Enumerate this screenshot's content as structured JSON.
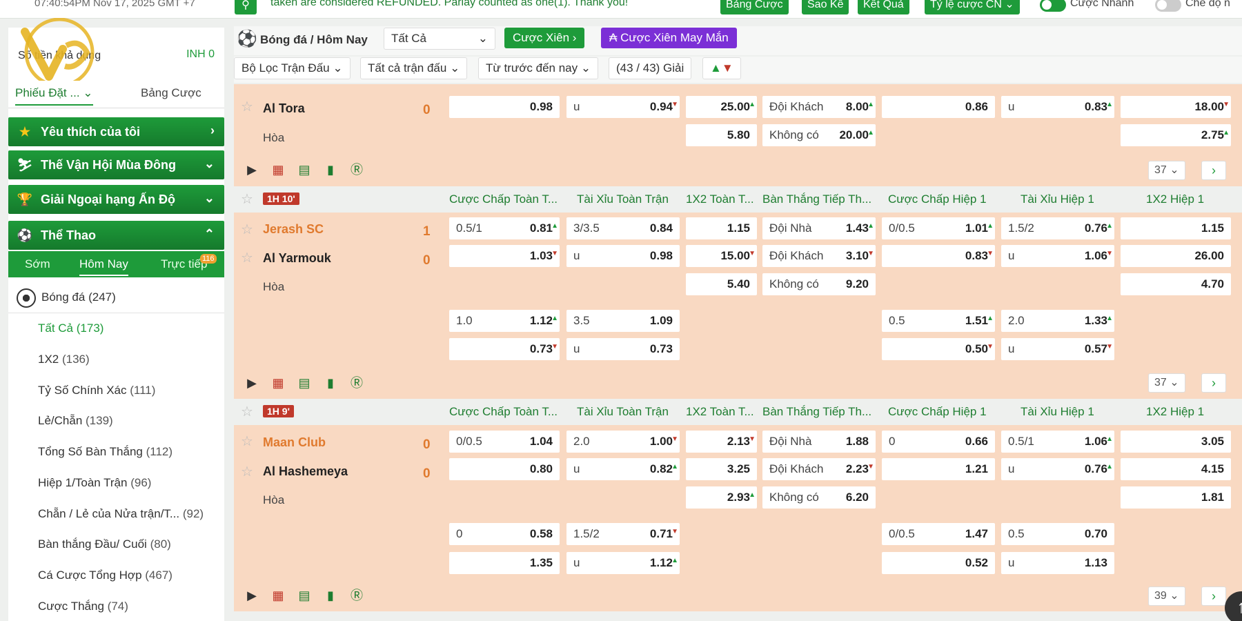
{
  "topbar": {
    "clock": "07:40:54PM Nov 17, 2025 GMT +7",
    "marquee": "taken are considered REFUNDED. Parlay counted as one(1). Thank you!",
    "buttons": [
      "Bảng Cược",
      "Sao Kê",
      "Kết Quả",
      "Tỷ lệ cược CN"
    ],
    "toggle1_label": "Cược Nhanh",
    "toggle2_label": "Chế độ n"
  },
  "account": {
    "label": "Số tiền khả dụng",
    "balance": "INH 0"
  },
  "sidebar_tabs": [
    "Phiếu Đặt ...",
    "Bảng Cược"
  ],
  "groups": [
    {
      "label": "Yêu thích của tôi",
      "icon": "star-icon"
    },
    {
      "label": "Thế Vận Hội Mùa Đông",
      "icon": "skier-icon"
    },
    {
      "label": "Giải Ngoại hạng Ấn Độ",
      "icon": "trophy-icon"
    },
    {
      "label": "Thể Thao",
      "icon": "soccer-ball-icon"
    }
  ],
  "sport_tabs": [
    "Sớm",
    "Hôm Nay",
    "Trực tiếp"
  ],
  "live_badge": "116",
  "sport": {
    "name": "Bóng đá",
    "count": "(247)"
  },
  "market_items": [
    {
      "label": "Tất Cả",
      "count": "(173)"
    },
    {
      "label": "1X2",
      "count": "(136)"
    },
    {
      "label": "Tỷ Số Chính Xác",
      "count": "(111)"
    },
    {
      "label": "Lẻ/Chẵn",
      "count": "(139)"
    },
    {
      "label": "Tổng Số Bàn Thắng",
      "count": "(112)"
    },
    {
      "label": "Hiệp 1/Toàn Trận",
      "count": "(96)"
    },
    {
      "label": "Chẵn / Lẻ của Nửa trận/T...",
      "count": "(92)"
    },
    {
      "label": "Bàn thắng Đầu/ Cuối",
      "count": "(80)"
    },
    {
      "label": "Cá Cược Tổng Hợp",
      "count": "(467)"
    },
    {
      "label": "Cược Thắng",
      "count": "(74)"
    }
  ],
  "header": {
    "breadcrumb": "Bóng đá / Hôm Nay",
    "filter_select": "Tất Cả",
    "parlay_btn": "Cược Xiên",
    "lucky_parlay_btn": "Cược Xiên May Mắn",
    "filter1": "Bộ Lọc Trận Đấu",
    "filter2": "Tất cả trận đấu",
    "filter3": "Từ trước đến nay",
    "league_count": "(43 / 43) Giải"
  },
  "columns": [
    "Cược Chấp Toàn T...",
    "Tài Xỉu Toàn Trận",
    "1X2 Toàn T...",
    "Bàn Thắng Tiếp Th...",
    "Cược Chấp Hiệp 1",
    "Tài Xỉu Hiệp 1",
    "1X2 Hiệp 1"
  ],
  "match0": {
    "away": "Al Tora",
    "away_score": "0",
    "draw": "Hòa",
    "row1": {
      "hdp_v": "0.98",
      "ou_l": "u",
      "ou_v": "0.94",
      "x12": "25.00",
      "ng_l": "Đội Khách",
      "ng_v": "8.00",
      "h1hdp_v": "0.86",
      "h1ou_l": "u",
      "h1ou_v": "0.83",
      "h1x12": "18.00"
    },
    "row2": {
      "x12": "5.80",
      "ng_l": "Không có",
      "ng_v": "20.00",
      "h1x12": "2.75"
    },
    "more": "37"
  },
  "match1": {
    "time": "1H 10'",
    "home": "Jerash SC",
    "home_score": "1",
    "away": "Al Yarmouk",
    "away_score": "0",
    "draw": "Hòa",
    "r1": {
      "hdp_l": "0.5/1",
      "hdp_v": "0.81",
      "ou_l": "3/3.5",
      "ou_v": "0.84",
      "x12": "1.15",
      "ng_l": "Đội Nhà",
      "ng_v": "1.43",
      "h1hdp_l": "0/0.5",
      "h1hdp_v": "1.01",
      "h1ou_l": "1.5/2",
      "h1ou_v": "0.76",
      "h1x12": "1.15"
    },
    "r2": {
      "hdp_v": "1.03",
      "ou_l": "u",
      "ou_v": "0.98",
      "x12": "15.00",
      "ng_l": "Đội Khách",
      "ng_v": "3.10",
      "h1hdp_v": "0.83",
      "h1ou_l": "u",
      "h1ou_v": "1.06",
      "h1x12": "26.00"
    },
    "r3": {
      "x12": "5.40",
      "ng_l": "Không có",
      "ng_v": "9.20",
      "h1x12": "4.70"
    },
    "r4": {
      "hdp_l": "1.0",
      "hdp_v": "1.12",
      "ou_l": "3.5",
      "ou_v": "1.09",
      "h1hdp_l": "0.5",
      "h1hdp_v": "1.51",
      "h1ou_l": "2.0",
      "h1ou_v": "1.33"
    },
    "r5": {
      "hdp_v": "0.73",
      "ou_l": "u",
      "ou_v": "0.73",
      "h1hdp_v": "0.50",
      "h1ou_l": "u",
      "h1ou_v": "0.57"
    },
    "more": "37"
  },
  "match2": {
    "time": "1H 9'",
    "home": "Maan Club",
    "home_score": "0",
    "away": "Al Hashemeya",
    "away_score": "0",
    "draw": "Hòa",
    "r1": {
      "hdp_l": "0/0.5",
      "hdp_v": "1.04",
      "ou_l": "2.0",
      "ou_v": "1.00",
      "x12": "2.13",
      "ng_l": "Đội Nhà",
      "ng_v": "1.88",
      "h1hdp_l": "0",
      "h1hdp_v": "0.66",
      "h1ou_l": "0.5/1",
      "h1ou_v": "1.06",
      "h1x12": "3.05"
    },
    "r2": {
      "hdp_v": "0.80",
      "ou_l": "u",
      "ou_v": "0.82",
      "x12": "3.25",
      "ng_l": "Đội Khách",
      "ng_v": "2.23",
      "h1hdp_v": "1.21",
      "h1ou_l": "u",
      "h1ou_v": "0.76",
      "h1x12": "4.15"
    },
    "r3": {
      "x12": "2.93",
      "ng_l": "Không có",
      "ng_v": "6.20",
      "h1x12": "1.81"
    },
    "r4": {
      "hdp_l": "0",
      "hdp_v": "0.58",
      "ou_l": "1.5/2",
      "ou_v": "0.71",
      "h1hdp_l": "0/0.5",
      "h1hdp_v": "1.47",
      "h1ou_l": "0.5",
      "h1ou_v": "0.70"
    },
    "r5": {
      "hdp_v": "1.35",
      "ou_l": "u",
      "ou_v": "1.12",
      "h1hdp_v": "0.52",
      "h1ou_l": "u",
      "h1ou_v": "1.13"
    },
    "more": "39"
  }
}
